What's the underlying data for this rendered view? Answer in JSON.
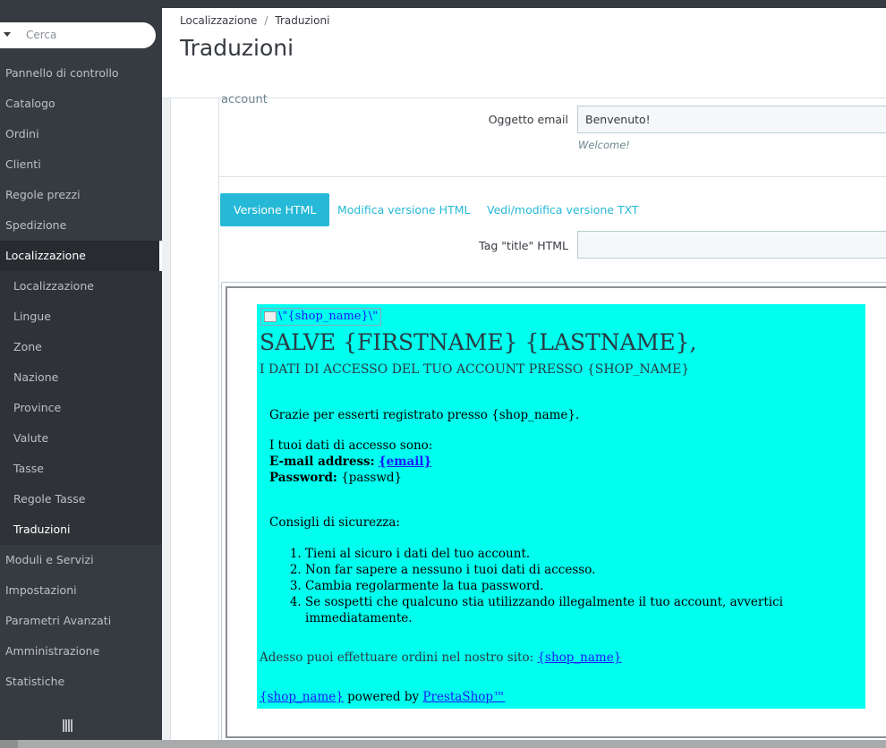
{
  "sidebar": {
    "search_placeholder": "Cerca",
    "items": [
      {
        "label": "Pannello di controllo"
      },
      {
        "label": "Catalogo"
      },
      {
        "label": "Ordini"
      },
      {
        "label": "Clienti"
      },
      {
        "label": "Regole prezzi"
      },
      {
        "label": "Spedizione"
      },
      {
        "label": "Localizzazione"
      }
    ],
    "subitems": [
      {
        "label": "Localizzazione"
      },
      {
        "label": "Lingue"
      },
      {
        "label": "Zone"
      },
      {
        "label": "Nazione"
      },
      {
        "label": "Province"
      },
      {
        "label": "Valute"
      },
      {
        "label": "Tasse"
      },
      {
        "label": "Regole Tasse"
      },
      {
        "label": "Traduzioni"
      }
    ],
    "items_after": [
      {
        "label": "Moduli e Servizi"
      },
      {
        "label": "Impostazioni"
      },
      {
        "label": "Parametri Avanzati"
      },
      {
        "label": "Amministrazione"
      },
      {
        "label": "Statistiche"
      }
    ]
  },
  "header": {
    "breadcrumb": [
      "Localizzazione",
      "/",
      "Traduzioni"
    ],
    "title": "Traduzioni"
  },
  "form": {
    "cut_label": "account",
    "subject_label": "Oggetto email",
    "subject_value": "Benvenuto!",
    "subject_help": "Welcome!",
    "tabs": [
      "Versione HTML",
      "Modifica versione HTML",
      "Vedi/modifica versione TXT"
    ],
    "title_tag_label": "Tag \"title\" HTML",
    "title_tag_value": ""
  },
  "email": {
    "logo_alt": "\\\"{shop_name}\\\"",
    "heading": "SALVE {FIRSTNAME} {LASTNAME},",
    "subheading": "I DATI DI ACCESSO DEL TUO ACCOUNT PRESSO {SHOP_NAME}",
    "thanks": "Grazie per esserti registrato presso {shop_name}.",
    "access_intro": "I tuoi dati di accesso sono:",
    "email_label": "E-mail address:",
    "email_value": "{email}",
    "password_label": "Password:",
    "password_value": "{passwd}",
    "security_title": "Consigli di sicurezza:",
    "tips": [
      "Tieni al sicuro i dati del tuo account.",
      "Non far sapere a nessuno i tuoi dati di accesso.",
      "Cambia regolarmente la tua password.",
      "Se sospetti che qualcuno stia utilizzando illegalmente il tuo account, avvertici immediatamente."
    ],
    "order_text": "Adesso puoi effettuare ordini nel nostro sito:",
    "order_link": "{shop_name}",
    "footer_shop": "{shop_name}",
    "footer_powered": "powered by",
    "footer_brand": "PrestaShop™"
  },
  "colors": {
    "sidebar_bg": "#363a41",
    "accent": "#25b9d7",
    "email_bg": "#00ffee"
  }
}
